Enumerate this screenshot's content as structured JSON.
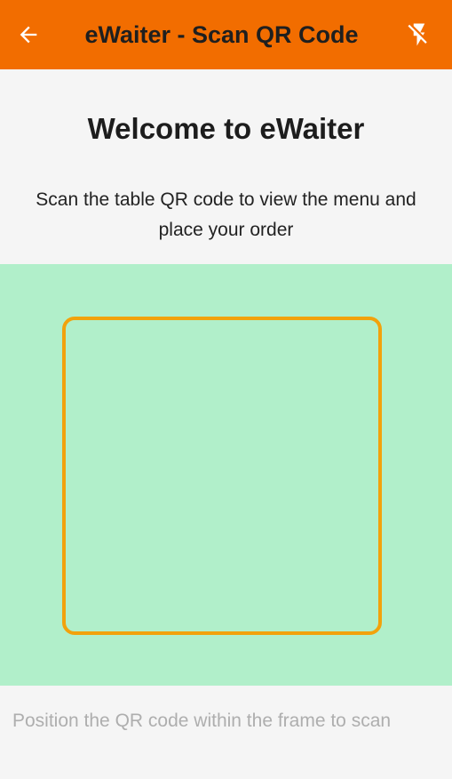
{
  "app_bar": {
    "title": "eWaiter - Scan QR Code",
    "back_icon": "arrow-back-icon",
    "flash_icon": "flash-off-icon",
    "background_color": "#f26d00"
  },
  "main": {
    "welcome_title": "Welcome to eWaiter",
    "instructions": "Scan the table QR code to view the menu and place your order"
  },
  "scanner": {
    "background_color": "#b1efca",
    "frame_color": "#f2a20c",
    "hint": "Position the QR code within the frame to scan"
  }
}
